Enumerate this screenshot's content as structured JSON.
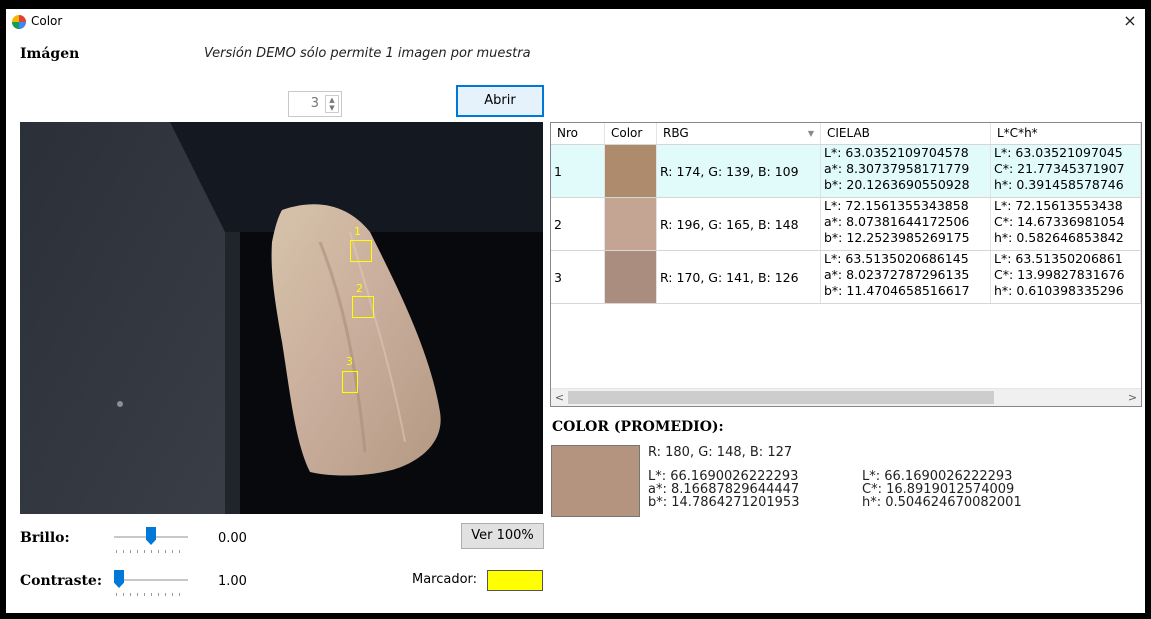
{
  "window": {
    "title": "Color",
    "close_glyph": "×"
  },
  "header": {
    "image_label": "Imágen",
    "demo_note": "Versión DEMO sólo permite 1 imagen por muestra"
  },
  "controls": {
    "sample_count": "3",
    "spinner_up": "▲",
    "spinner_down": "▼",
    "open_button": "Abrir",
    "view_100_button": "Ver 100%",
    "brightness_label": "Brillo:",
    "brightness_value": "0.00",
    "brightness_level": 0.5,
    "contrast_label": "Contraste:",
    "contrast_value": "1.00",
    "contrast_level": 0.0,
    "marker_label": "Marcador:",
    "marker_color": "#ffff00"
  },
  "markers": [
    {
      "label": "1"
    },
    {
      "label": "2"
    },
    {
      "label": "3"
    }
  ],
  "grid": {
    "columns": [
      "Nro",
      "Color",
      "RBG",
      "CIELAB",
      "L*C*h*"
    ],
    "rows": [
      {
        "nro": "1",
        "color": "#ae8b6d",
        "rgb": "R: 174, G: 139, B: 109",
        "cielab": "L*: 63.0352109704578\na*: 8.30737958171779\nb*: 20.1263690550928",
        "lch": "L*: 63.03521097045\nC*: 21.77345371907\nh*: 0.391458578746"
      },
      {
        "nro": "2",
        "color": "#c4a594",
        "rgb": "R: 196, G: 165, B: 148",
        "cielab": "L*: 72.1561355343858\na*: 8.07381644172506\nb*: 12.2523985269175",
        "lch": "L*: 72.15613553438\nC*: 14.67336981054\nh*: 0.582646853842"
      },
      {
        "nro": "3",
        "color": "#aa8d7e",
        "rgb": "R: 170, G: 141, B: 126",
        "cielab": "L*: 63.5135020686145\na*: 8.02372787296135\nb*: 11.4704658516617",
        "lch": "L*: 63.51350206861\nC*: 13.99827831676\nh*: 0.610398335296"
      }
    ],
    "scroll_left": "<",
    "scroll_right": ">"
  },
  "average": {
    "title": "COLOR (PROMEDIO):",
    "color": "#b4947f",
    "rgb": "R: 180, G: 148, B: 127",
    "cielab": "L*: 66.1690026222293\na*: 8.16687829644447\nb*: 14.7864271201953",
    "lch": "L*: 66.1690026222293\nC*: 16.8919012574009\nh*: 0.504624670082001"
  }
}
